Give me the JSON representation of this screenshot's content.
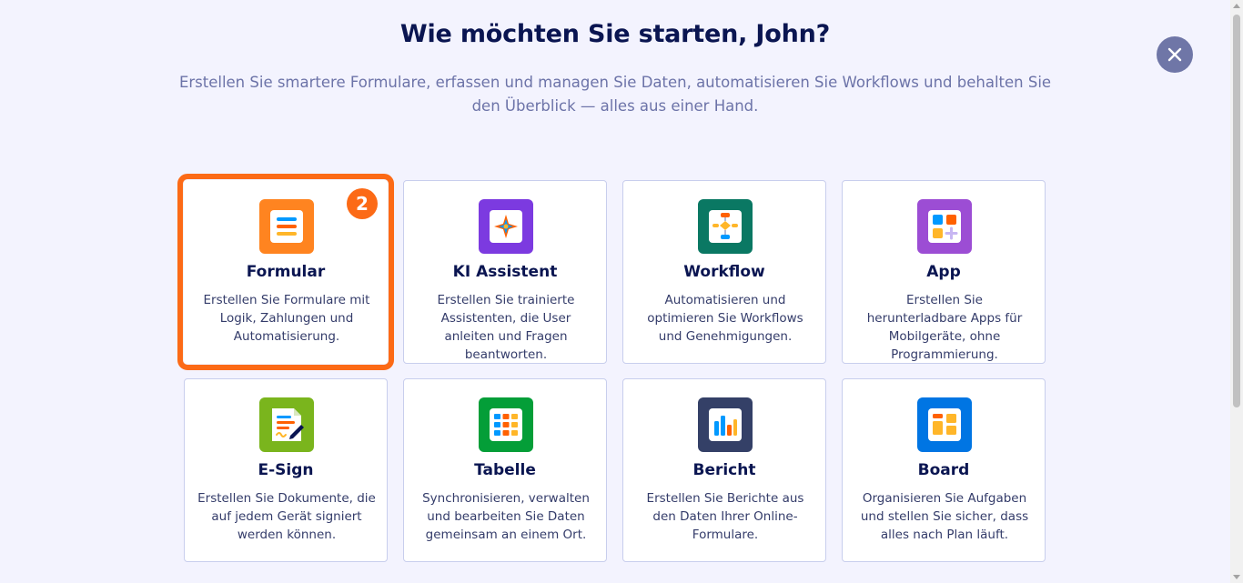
{
  "header": {
    "title": "Wie möchten Sie starten, John?",
    "subtitle": "Erstellen Sie smartere Formulare, erfassen und managen Sie Daten, automatisieren Sie Workflows und behalten Sie den Überblick — alles aus einer Hand."
  },
  "close": {
    "icon": "close-icon"
  },
  "step_badge": "2",
  "cards": [
    {
      "title": "Formular",
      "desc": "Erstellen Sie Formulare mit Logik, Zahlungen und Automatisierung.",
      "icon": "form-icon",
      "color": "#ff6100"
    },
    {
      "title": "KI Assistent",
      "desc": "Erstellen Sie trainierte Assistenten, die User anleiten und Fragen beantworten.",
      "icon": "ai-agent-icon",
      "color": "#7c3ae0"
    },
    {
      "title": "Workflow",
      "desc": "Automatisieren und optimieren Sie Workflows und Genehmigungen.",
      "icon": "workflow-icon",
      "color": "#0a7863"
    },
    {
      "title": "App",
      "desc": "Erstellen Sie herunterladbare Apps für Mobilgeräte, ohne Programmierung.",
      "icon": "app-icon",
      "color": "#9c4dd4"
    },
    {
      "title": "E-Sign",
      "desc": "Erstellen Sie Dokumente, die auf jedem Gerät signiert werden können.",
      "icon": "esign-icon",
      "color": "#7ab51d"
    },
    {
      "title": "Tabelle",
      "desc": "Synchronisieren, verwalten und bearbeiten Sie Daten gemeinsam an einem Ort.",
      "icon": "table-icon",
      "color": "#049e38"
    },
    {
      "title": "Bericht",
      "desc": "Erstellen Sie Berichte aus den Daten Ihrer Online-Formulare.",
      "icon": "report-icon",
      "color": "#344067"
    },
    {
      "title": "Board",
      "desc": "Organisieren Sie Aufgaben und stellen Sie sicher, dass alles nach Plan läuft.",
      "icon": "board-icon",
      "color": "#0075e3"
    }
  ]
}
